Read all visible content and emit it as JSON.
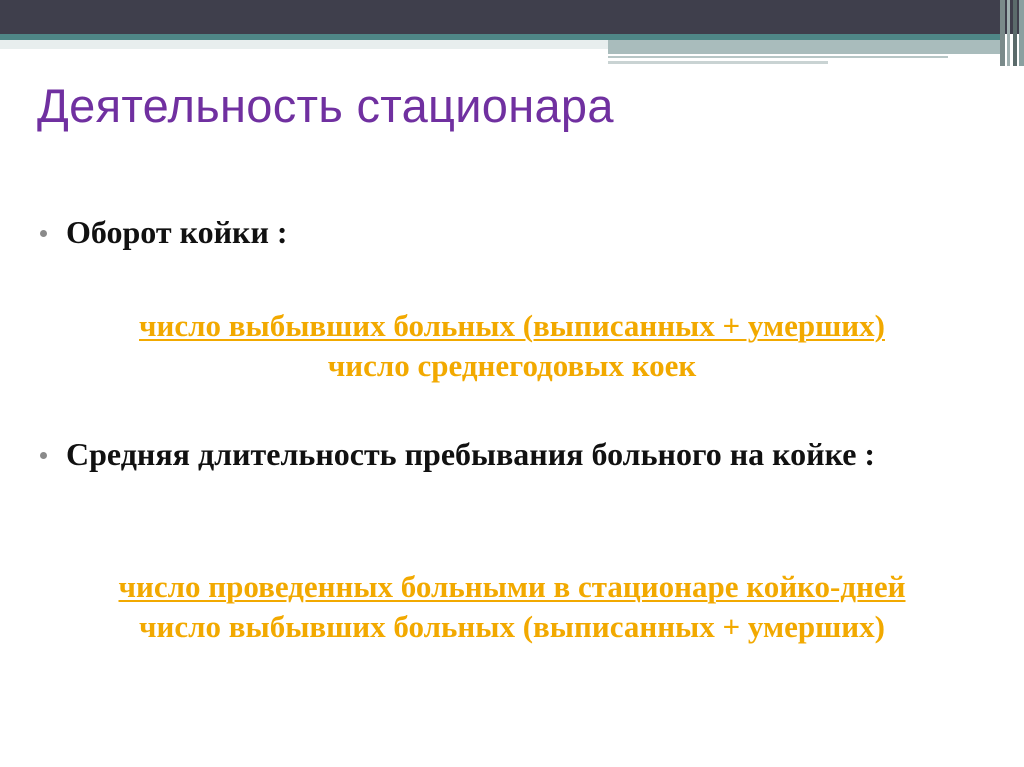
{
  "slide": {
    "title": "Деятельность стационара"
  },
  "bullets": [
    {
      "text": "Оборот койки :"
    },
    {
      "text": "Средняя длительность пребывания больного на койке :"
    }
  ],
  "formulas": [
    {
      "numerator": "число выбывших больных (выписанных + умерших)",
      "denominator": "число среднегодовых коек"
    },
    {
      "numerator": "число проведенных больными в стационаре койко-дней",
      "denominator": "число выбывших больных (выписанных + умерших)"
    }
  ],
  "colors": {
    "title": "#7030a0",
    "formula": "#f2a900",
    "header_dark": "#3f3f4c",
    "header_teal": "#4f8787"
  }
}
